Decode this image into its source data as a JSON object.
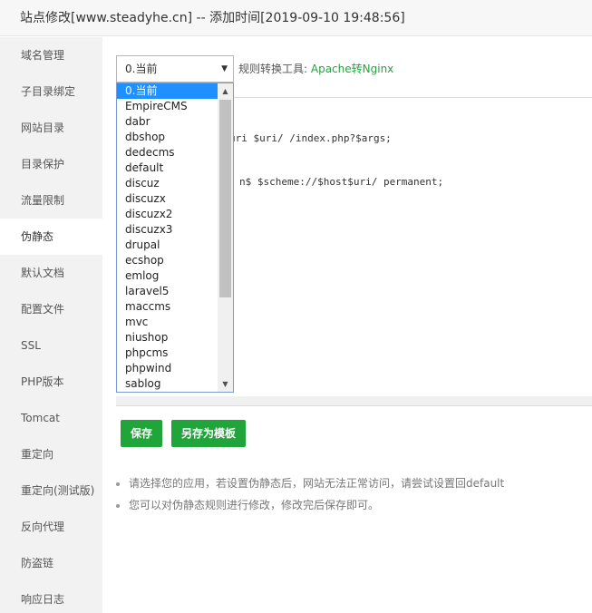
{
  "title": "站点修改[www.steadyhe.cn] -- 添加时间[2019-09-10 19:48:56]",
  "sidebar": {
    "items": [
      {
        "label": "域名管理"
      },
      {
        "label": "子目录绑定"
      },
      {
        "label": "网站目录"
      },
      {
        "label": "目录保护"
      },
      {
        "label": "流量限制"
      },
      {
        "label": "伪静态"
      },
      {
        "label": "默认文档"
      },
      {
        "label": "配置文件"
      },
      {
        "label": "SSL"
      },
      {
        "label": "PHP版本"
      },
      {
        "label": "Tomcat"
      },
      {
        "label": "重定向"
      },
      {
        "label": "重定向(测试版)"
      },
      {
        "label": "反向代理"
      },
      {
        "label": "防盗链"
      },
      {
        "label": "响应日志"
      }
    ],
    "active_index": 5
  },
  "rewrite": {
    "selected": "0.当前",
    "tool_label": "规则转换工具:",
    "tool_link": "Apache转Nginx",
    "options": [
      "0.当前",
      "EmpireCMS",
      "dabr",
      "dbshop",
      "dedecms",
      "default",
      "discuz",
      "discuzx",
      "discuzx2",
      "discuzx3",
      "drupal",
      "ecshop",
      "emlog",
      "laravel5",
      "maccms",
      "mvc",
      "niushop",
      "phpcms",
      "phpwind",
      "sablog"
    ],
    "code_visible": [
      "uri $uri/ /index.php?$args;",
      "n$ $scheme://$host$uri/ permanent;"
    ]
  },
  "buttons": {
    "save": "保存",
    "save_as_template": "另存为模板"
  },
  "tips": [
    "请选择您的应用，若设置伪静态后，网站无法正常访问，请尝试设置回default",
    "您可以对伪静态规则进行修改，修改完后保存即可。"
  ],
  "colors": {
    "accent": "#20a53a",
    "selected_option": "#1e90ff"
  }
}
